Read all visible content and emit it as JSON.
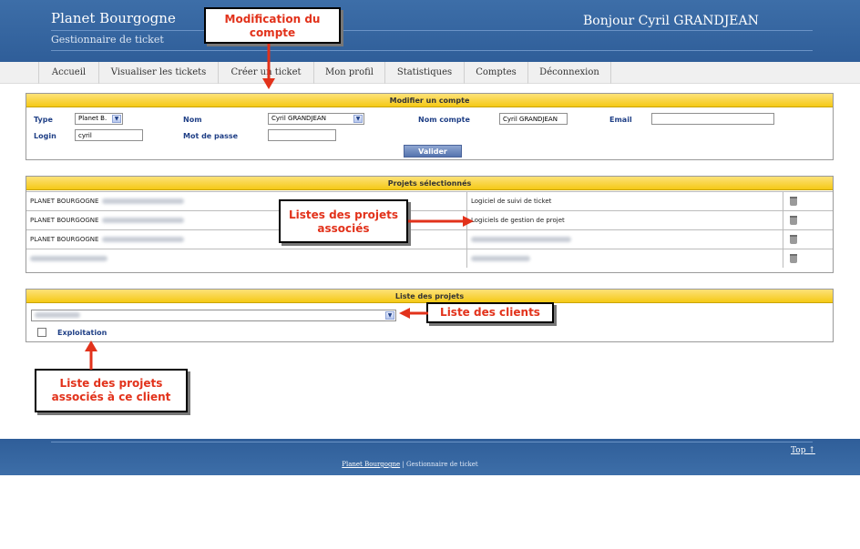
{
  "header": {
    "site_title": "Planet Bourgogne",
    "site_subtitle": "Gestionnaire de ticket",
    "greeting": "Bonjour Cyril GRANDJEAN"
  },
  "nav": {
    "items": [
      "Accueil",
      "Visualiser les tickets",
      "Créer un ticket",
      "Mon profil",
      "Statistiques",
      "Comptes",
      "Déconnexion"
    ]
  },
  "modifier_compte": {
    "title": "Modifier un compte",
    "type_label": "Type",
    "type_value": "Planet B.",
    "nom_label": "Nom",
    "nom_value": "Cyril GRANDJEAN",
    "nom_compte_label": "Nom compte",
    "nom_compte_value": "Cyril GRANDJEAN",
    "email_label": "Email",
    "email_value": "",
    "login_label": "Login",
    "login_value": "cyril",
    "mdp_label": "Mot de passe",
    "mdp_value": "",
    "submit_label": "Valider"
  },
  "projets_selectionnes": {
    "title": "Projets sélectionnés",
    "rows": [
      {
        "client": "PLANET BOURGOGNE",
        "projet": "Logiciel de suivi de ticket"
      },
      {
        "client": "PLANET BOURGOGNE",
        "projet": "Logiciels de gestion de projet"
      },
      {
        "client": "PLANET BOURGOGNE",
        "projet": ""
      },
      {
        "client": "",
        "projet": ""
      }
    ]
  },
  "liste_projets": {
    "title": "Liste des projets",
    "client_select_value": "",
    "checkbox_label": "Exploitation"
  },
  "callouts": {
    "modification": "Modification du compte",
    "projets_associes": "Listes des projets associés",
    "liste_clients": "Liste des clients",
    "projets_client": "Liste des projets associés à ce client"
  },
  "footer": {
    "link": "Planet Bourgogne",
    "text": " | Gestionnaire de ticket",
    "top_link": "Top ↑"
  }
}
